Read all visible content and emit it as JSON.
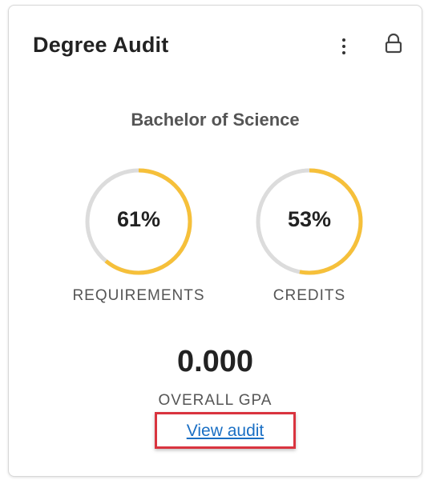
{
  "card": {
    "title": "Degree Audit",
    "menu_icon": "kebab-menu-icon",
    "lock_icon": "lock-icon"
  },
  "degree": "Bachelor of Science",
  "progress": [
    {
      "label": "REQUIREMENTS",
      "value_text": "61%",
      "value": 61
    },
    {
      "label": "CREDITS",
      "value_text": "53%",
      "value": 53
    }
  ],
  "gpa": {
    "value": "0.000",
    "label": "OVERALL GPA"
  },
  "audit_link": "View audit",
  "colors": {
    "progress": "#f6c03a",
    "track": "#dcdcdc",
    "link": "#1a6fc4",
    "highlight": "#d9343f"
  }
}
